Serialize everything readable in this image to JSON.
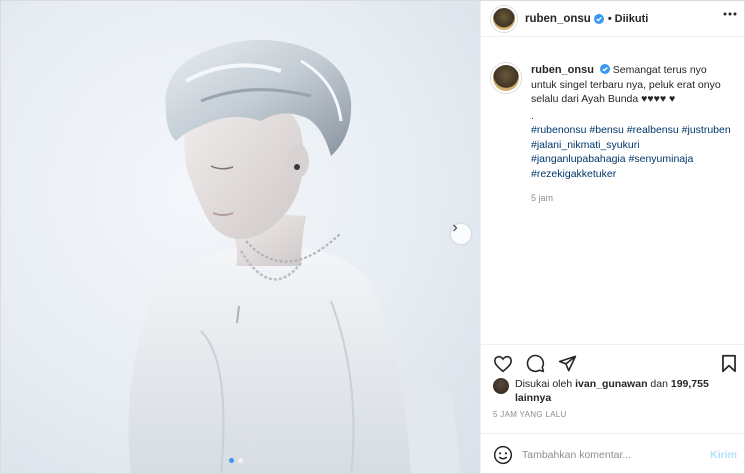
{
  "post": {
    "username": "ruben_onsu",
    "follow_separator": "•",
    "follow_status": "Diikuti",
    "caption": {
      "username": "ruben_onsu",
      "text": "Semangat terus nyo untuk singel terbaru nya, peluk erat onyo selalu dari Ayah Bunda ♥♥♥♥ ♥",
      "dot": ".",
      "hashtags": [
        "#rubenonsu",
        "#bensu",
        "#realbensu",
        "#justruben",
        "#jalani_nikmati_syukuri",
        "#janganlupabahagia",
        "#senyuminaja",
        "#rezekigakketuker"
      ],
      "time_ago": "5 jam"
    },
    "likes": {
      "prefix": "Disukai oleh",
      "liked_by": "ivan_gunawan",
      "connector": "dan",
      "others": "199,755 lainnya"
    },
    "posted_ago": "5 JAM YANG LALU",
    "comment": {
      "placeholder": "Tambahkan komentar...",
      "post_label": "Kirim"
    }
  },
  "carousel": {
    "count": 2,
    "current": 1
  },
  "colors": {
    "accent": "#3897f0",
    "link": "#00376b",
    "muted": "#8e8e8e",
    "post_disabled": "#b2dffc"
  },
  "icons": [
    "more-icon",
    "verified-icon",
    "heart-icon",
    "comment-icon",
    "share-icon",
    "bookmark-icon",
    "emoji-icon",
    "chevron-right-icon"
  ]
}
